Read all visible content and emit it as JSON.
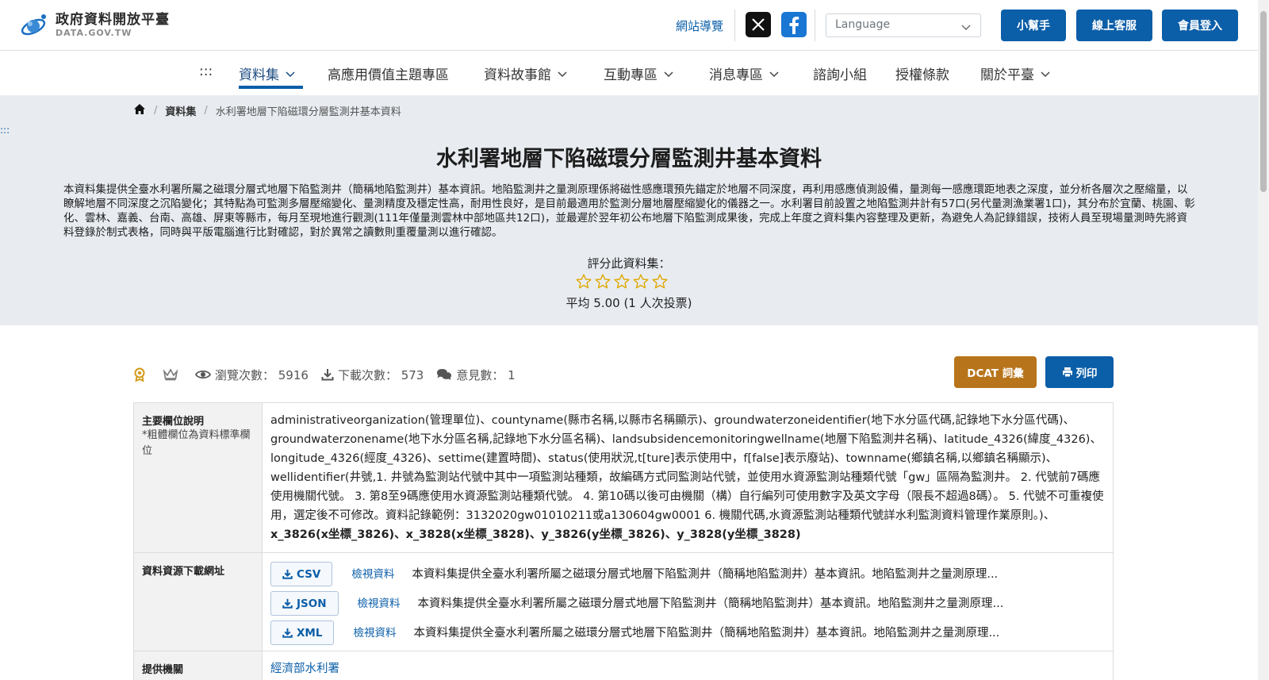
{
  "header": {
    "logo_zh": "政府資料開放平臺",
    "logo_en": "DATA.GOV.TW",
    "sitemap": "網站導覽",
    "language_placeholder": "Language",
    "buttons": {
      "helper": "小幫手",
      "support": "線上客服",
      "login": "會員登入"
    }
  },
  "nav": {
    "skip": ":::",
    "items": [
      "資料集",
      "高應用價值主題專區",
      "資料故事館",
      "互動專區",
      "消息專區",
      "諮詢小組",
      "授權條款",
      "關於平臺"
    ]
  },
  "breadcrumb": {
    "items": [
      "資料集",
      "水利署地層下陷磁環分層監測井基本資料"
    ]
  },
  "skip_link": ":::",
  "dataset": {
    "title": "水利署地層下陷磁環分層監測井基本資料",
    "description": "本資料集提供全臺水利署所屬之磁環分層式地層下陷監測井（簡稱地陷監測井）基本資訊。地陷監測井之量測原理係將磁性感應環預先錨定於地層不同深度，再利用感應偵測設備，量測每一感應環距地表之深度，並分析各層次之壓縮量，以瞭解地層不同深度之沉陷變化；其特點為可監測多層壓縮變化、量測精度及穩定性高，耐用性良好，是目前最適用於監測分層地層壓縮變化的儀器之一。水利署目前設置之地陷監測井計有57口(另代量測漁業署1口)，其分布於宜蘭、桃園、彰化、雲林、嘉義、台南、高雄、屏東等縣市，每月至現地進行觀測(111年僅量測雲林中部地區共12口)，並最遲於翌年初公布地層下陷監測成果後，完成上年度之資料集內容整理及更新，為避免人為記錄錯誤，技術人員至現場量測時先將資料登錄於制式表格，同時與平版電腦進行比對確認，對於異常之讀數則重覆量測以進行確認。",
    "rating_label": "評分此資料集：",
    "rating_value": 5,
    "rating_max": 5,
    "average": "平均 5.00 (1 人次投票)"
  },
  "stats": {
    "views": "瀏覽次數： 5916",
    "downloads": "下載次數： 573",
    "comments": "意見數： 1"
  },
  "actions": {
    "dcat": "DCAT 詞彙",
    "print": "列印"
  },
  "table": {
    "fields_header": "主要欄位說明",
    "fields_note": "*粗體欄位為資料標準欄位",
    "fields_text": "administrativeorganization(管理單位)、countyname(縣市名稱,以縣市名稱顯示)、groundwaterzoneidentifier(地下水分區代碼,記錄地下水分區代碼)、groundwaterzonename(地下水分區名稱,記錄地下水分區名稱)、landsubsidencemonitoringwellname(地層下陷監測井名稱)、latitude_4326(緯度_4326)、longitude_4326(經度_4326)、settime(建置時間)、status(使用狀況,t[ture]表示使用中，f[false]表示廢站)、townname(鄉鎮名稱,以鄉鎮名稱顯示)、wellidentifier(井號,1. 井號為監測站代號中其中一項監測站種類，故編碼方式同監測站代號，並使用水資源監測站種類代號「gw」區隔為監測井。 2. 代號前7碼應使用機關代號。 3. 第8至9碼應使用水資源監測站種類代號。 4. 第10碼以後可由機關（構）自行編列可使用數字及英文字母（限長不超過8碼）。 5. 代號不可重複使用，選定後不可修改。資料記錄範例：3132020gw01010211或a130604gw0001 6. 機關代碼,水資源監測站種類代號詳水利監測資料管理作業原則。)、",
    "fields_bold": "x_3826(x坐標_3826)、x_3828(x坐標_3828)、y_3826(y坐標_3826)、y_3828(y坐標_3828)",
    "resources_header": "資料資源下載網址",
    "resources": [
      {
        "format": "CSV",
        "view": "檢視資料",
        "desc": "本資料集提供全臺水利署所屬之磁環分層式地層下陷監測井（簡稱地陷監測井）基本資訊。地陷監測井之量測原理..."
      },
      {
        "format": "JSON",
        "view": "檢視資料",
        "desc": "本資料集提供全臺水利署所屬之磁環分層式地層下陷監測井（簡稱地陷監測井）基本資訊。地陷監測井之量測原理..."
      },
      {
        "format": "XML",
        "view": "檢視資料",
        "desc": "本資料集提供全臺水利署所屬之磁環分層式地層下陷監測井（簡稱地陷監測井）基本資訊。地陷監測井之量測原理..."
      }
    ],
    "provider_header": "提供機關",
    "provider": "經濟部水利署"
  },
  "colors": {
    "primary": "#0b5ea8",
    "dcat": "#b8741a",
    "hero_bg": "#e8ecf1",
    "star": "#e0a800"
  }
}
